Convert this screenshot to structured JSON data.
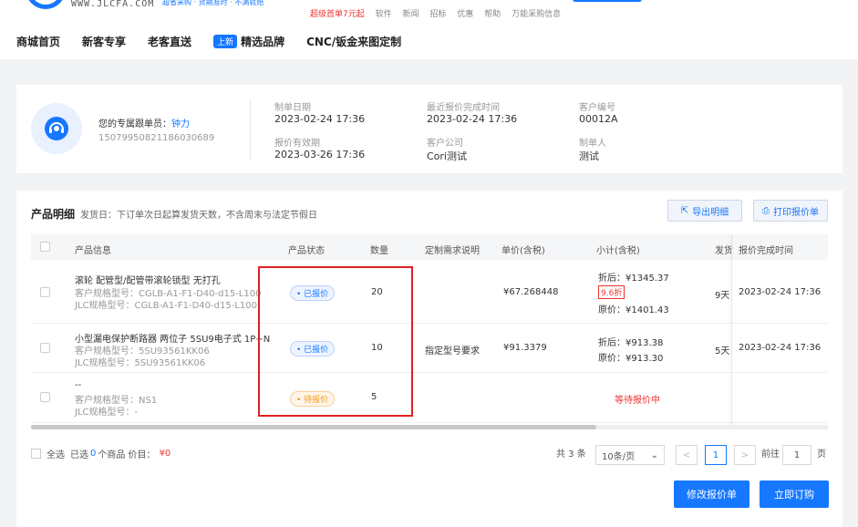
{
  "header": {
    "site_url": "WWW.JLCFA.COM",
    "slogan": "超省采购 · 货期准时 · 不满就赔",
    "top_links": [
      "超级首单7元起",
      "软件",
      "新闻",
      "招标",
      "优惠",
      "帮助",
      "万能采购信息"
    ],
    "nav": [
      "商城首页",
      "新客专享",
      "老客直送",
      "精选品牌",
      "CNC/钣金来图定制"
    ],
    "new_badge": "上新"
  },
  "info": {
    "rep_label": "您的专属跟单员：",
    "rep_name": "钟力",
    "rep_id": "15079950821186030689",
    "fields": [
      {
        "label": "制单日期",
        "value": "2023-02-24 17:36"
      },
      {
        "label": "最近报价完成时间",
        "value": "2023-02-24 17:36"
      },
      {
        "label": "客户编号",
        "value": "00012A"
      },
      {
        "label": "报价有效期",
        "value": "2023-03-26 17:36"
      },
      {
        "label": "客户公司",
        "value": "Cori测试"
      },
      {
        "label": "制单人",
        "value": "测试"
      }
    ]
  },
  "products": {
    "title": "产品明细",
    "note": "发货日：下订单次日起算发货天数，不含周末与法定节假日",
    "export_label": "导出明细",
    "print_label": "打印报价单",
    "columns": [
      "产品信息",
      "产品状态",
      "数量",
      "定制需求说明",
      "单价(含税)",
      "小计(含税)",
      "发货",
      "报价完成时间"
    ],
    "rows": [
      {
        "name": "滚轮 配管型/配管带滚轮锁型 无打孔",
        "cust_model": "客户规格型号：CGLB-A1-F1-D40-d15-L100",
        "jlc_model": "JLC规格型号：CGLB-A1-F1-D40-d15-L100",
        "status": "已报价",
        "qty": "20",
        "req": "",
        "unit": "¥67.268448",
        "discount_label": "折后：¥1345.37",
        "discount_tag": "9.6折",
        "original_label": "原价：¥1401.43",
        "ship": "9天",
        "done_time": "2023-02-24 17:36"
      },
      {
        "name": "小型漏电保护断路器 两位子 5SU9电子式 1P+N",
        "cust_model": "客户规格型号：5SU93561KK06",
        "jlc_model": "JLC规格型号：5SU93561KK06",
        "status": "已报价",
        "qty": "10",
        "req": "指定型号要求",
        "unit": "¥91.3379",
        "discount_label": "折后：¥913.38",
        "discount_tag": "",
        "original_label": "原价：¥913.30",
        "ship": "5天",
        "done_time": "2023-02-24 17:36"
      },
      {
        "name": "--",
        "cust_model": "客户规格型号：NS1",
        "jlc_model": "JLC规格型号：-",
        "status": "待报价",
        "qty": "5",
        "req": "",
        "unit": "",
        "pending_price": "等待报价中",
        "ship": "",
        "done_time": ""
      }
    ]
  },
  "footer": {
    "select_all": "全选",
    "selected_prefix": "已选",
    "selected_count": "0",
    "selected_suffix": "个商品 价目：",
    "total": "¥0",
    "total_label": "共 3 条",
    "page_size": "10条/页",
    "prev": "<",
    "page": "1",
    "next": ">",
    "goto_label": "前往",
    "goto_value": "1",
    "page_unit": "页",
    "modify_btn": "修改报价单",
    "order_btn": "立即订购"
  },
  "colors": {
    "accent": "#1677ff",
    "danger": "#e33333",
    "warning": "#f39a1f"
  }
}
